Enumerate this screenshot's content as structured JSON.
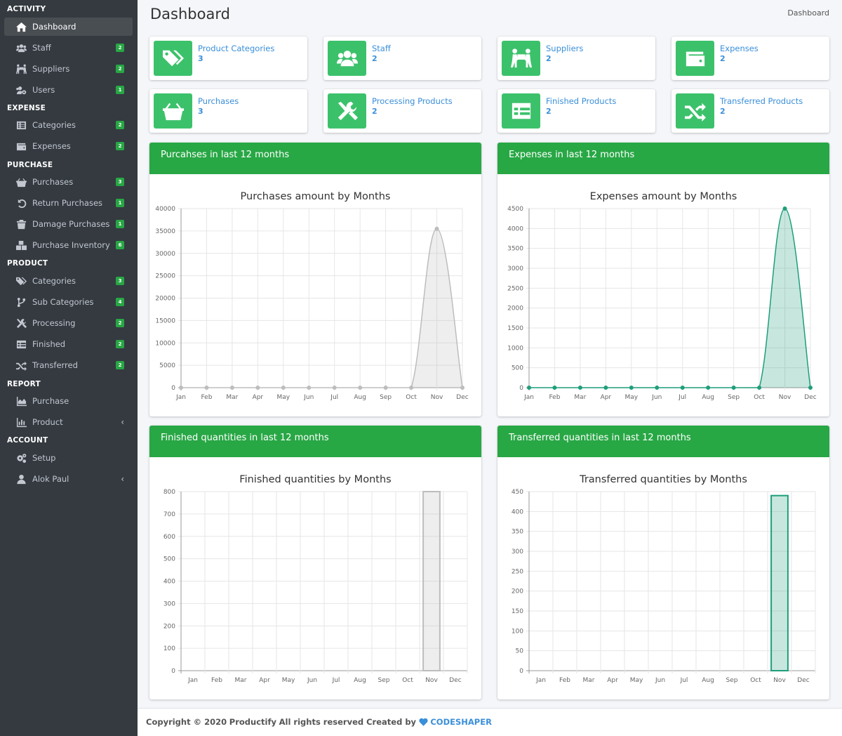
{
  "sidebar": {
    "sections": [
      {
        "title": "ACTIVITY",
        "items": [
          {
            "label": "Dashboard",
            "icon": "home-icon",
            "active": true
          },
          {
            "label": "Staff",
            "icon": "users-icon",
            "badge": "2"
          },
          {
            "label": "Suppliers",
            "icon": "people-carry-icon",
            "badge": "2"
          },
          {
            "label": "Users",
            "icon": "users-cog-icon",
            "badge": "1"
          }
        ]
      },
      {
        "title": "EXPENSE",
        "items": [
          {
            "label": "Categories",
            "icon": "list-icon",
            "badge": "2"
          },
          {
            "label": "Expenses",
            "icon": "wallet-icon",
            "badge": "2"
          }
        ]
      },
      {
        "title": "PURCHASE",
        "items": [
          {
            "label": "Purchases",
            "icon": "basket-icon",
            "badge": "3"
          },
          {
            "label": "Return Purchases",
            "icon": "undo-icon",
            "badge": "1"
          },
          {
            "label": "Damage Purchases",
            "icon": "trash-icon",
            "badge": "1"
          },
          {
            "label": "Purchase Inventory",
            "icon": "boxes-icon",
            "badge": "6"
          }
        ]
      },
      {
        "title": "PRODUCT",
        "items": [
          {
            "label": "Categories",
            "icon": "tags-icon",
            "badge": "3"
          },
          {
            "label": "Sub Categories",
            "icon": "code-branch-icon",
            "badge": "4"
          },
          {
            "label": "Processing",
            "icon": "tools-icon",
            "badge": "2"
          },
          {
            "label": "Finished",
            "icon": "table-icon",
            "badge": "2"
          },
          {
            "label": "Transferred",
            "icon": "random-icon",
            "badge": "2"
          }
        ]
      },
      {
        "title": "REPORT",
        "items": [
          {
            "label": "Purchase",
            "icon": "area-chart-icon"
          },
          {
            "label": "Product",
            "icon": "bar-chart-icon",
            "chevron": "‹"
          }
        ]
      },
      {
        "title": "ACCOUNT",
        "items": [
          {
            "label": "Setup",
            "icon": "cogs-icon"
          },
          {
            "label": "Alok Paul",
            "icon": "user-icon",
            "chevron": "‹"
          }
        ]
      }
    ]
  },
  "header": {
    "title": "Dashboard",
    "breadcrumb": "Dashboard"
  },
  "info_boxes": [
    {
      "label": "Product Categories",
      "value": "3",
      "icon": "tags-icon"
    },
    {
      "label": "Staff",
      "value": "2",
      "icon": "users-icon"
    },
    {
      "label": "Suppliers",
      "value": "2",
      "icon": "people-carry-icon"
    },
    {
      "label": "Expenses",
      "value": "2",
      "icon": "wallet-icon"
    },
    {
      "label": "Purchases",
      "value": "3",
      "icon": "basket-icon"
    },
    {
      "label": "Processing Products",
      "value": "2",
      "icon": "tools-icon"
    },
    {
      "label": "Finished Products",
      "value": "2",
      "icon": "table-icon"
    },
    {
      "label": "Transferred Products",
      "value": "2",
      "icon": "random-icon"
    }
  ],
  "colors": {
    "accent": "#28a745",
    "icon_bg": "#3cc16b",
    "link": "#3a8fd9",
    "sidebar": "#343a40",
    "series_teal": "#1f9e7a",
    "series_gray": "#bdbdbd"
  },
  "cards": [
    {
      "header": "Purcahses in last 12 months"
    },
    {
      "header": "Expenses in last 12 months"
    },
    {
      "header": "Finished quantities in last 12 months"
    },
    {
      "header": "Transferred quantities in last 12 months"
    }
  ],
  "chart_data": [
    {
      "type": "area",
      "title": "Purchases amount by Months",
      "categories": [
        "Jan",
        "Feb",
        "Mar",
        "Apr",
        "May",
        "Jun",
        "Jul",
        "Aug",
        "Sep",
        "Oct",
        "Nov",
        "Dec"
      ],
      "values": [
        0,
        0,
        0,
        0,
        0,
        0,
        0,
        0,
        0,
        0,
        35500,
        0
      ],
      "ylim": [
        0,
        40000
      ],
      "yticks": [
        0,
        5000,
        10000,
        15000,
        20000,
        25000,
        30000,
        35000,
        40000
      ],
      "color": "#bdbdbd",
      "grid": true
    },
    {
      "type": "area",
      "title": "Expenses amount by Months",
      "categories": [
        "Jan",
        "Feb",
        "Mar",
        "Apr",
        "May",
        "Jun",
        "Jul",
        "Aug",
        "Sep",
        "Oct",
        "Nov",
        "Dec"
      ],
      "values": [
        0,
        0,
        0,
        0,
        0,
        0,
        0,
        0,
        0,
        0,
        4500,
        0
      ],
      "ylim": [
        0,
        4500
      ],
      "yticks": [
        0,
        500,
        1000,
        1500,
        2000,
        2500,
        3000,
        3500,
        4000,
        4500
      ],
      "color": "#1f9e7a",
      "grid": true
    },
    {
      "type": "bar",
      "title": "Finished quantities by Months",
      "categories": [
        "Jan",
        "Feb",
        "Mar",
        "Apr",
        "May",
        "Jun",
        "Jul",
        "Aug",
        "Sep",
        "Oct",
        "Nov",
        "Dec"
      ],
      "values": [
        0,
        0,
        0,
        0,
        0,
        0,
        0,
        0,
        0,
        0,
        800,
        0
      ],
      "ylim": [
        0,
        800
      ],
      "yticks": [
        0,
        100,
        200,
        300,
        400,
        500,
        600,
        700,
        800
      ],
      "color": "#bdbdbd",
      "grid": true
    },
    {
      "type": "bar",
      "title": "Transferred quantities by Months",
      "categories": [
        "Jan",
        "Feb",
        "Mar",
        "Apr",
        "May",
        "Jun",
        "Jul",
        "Aug",
        "Sep",
        "Oct",
        "Nov",
        "Dec"
      ],
      "values": [
        0,
        0,
        0,
        0,
        0,
        0,
        0,
        0,
        0,
        0,
        440,
        0
      ],
      "ylim": [
        0,
        450
      ],
      "yticks": [
        0,
        50,
        100,
        150,
        200,
        250,
        300,
        350,
        400,
        450
      ],
      "color": "#1f9e7a",
      "grid": true
    }
  ],
  "footer": {
    "prefix": "Copyright © 2020",
    "app": "Productify",
    "suffix": "All rights reserved Created by",
    "brand": "CODESHAPER"
  }
}
